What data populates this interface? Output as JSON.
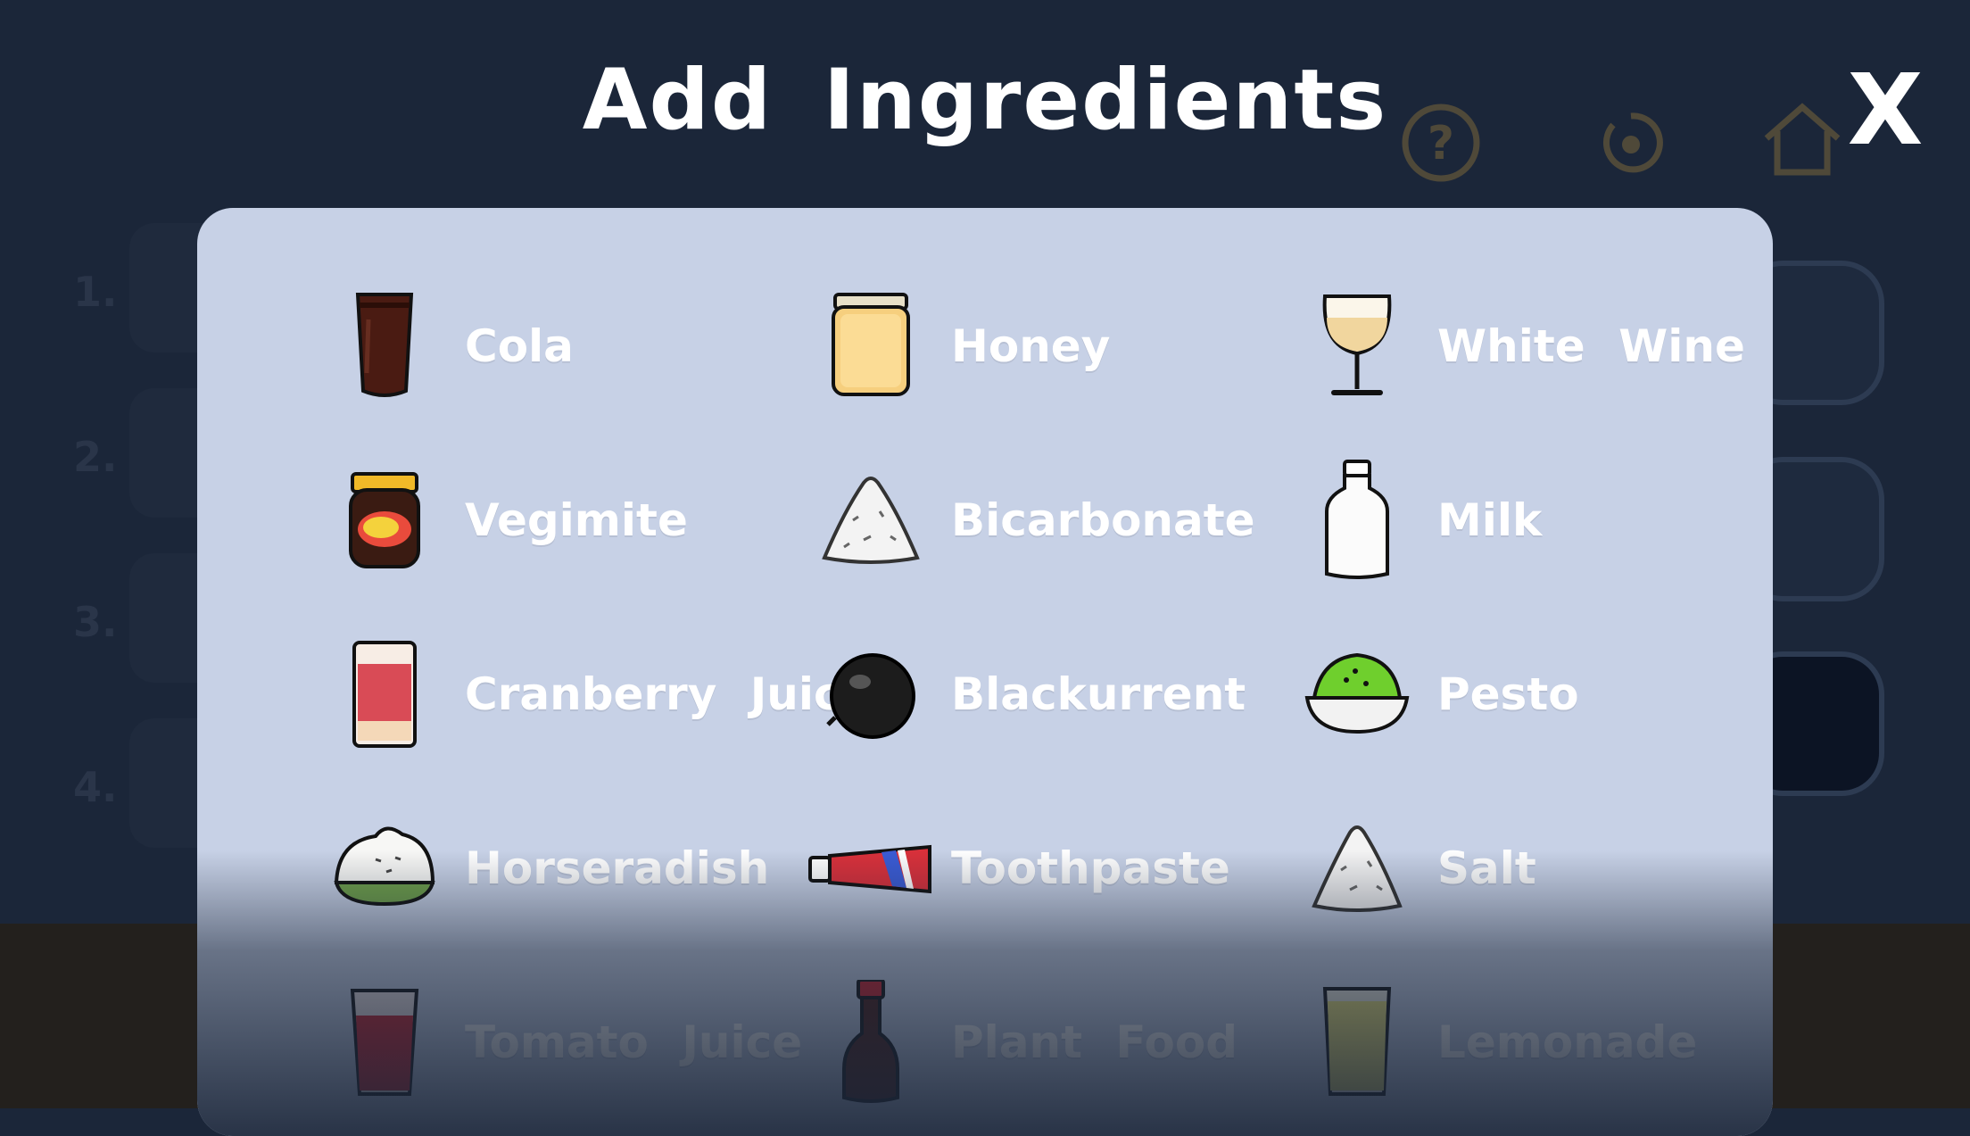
{
  "header": {
    "title": "Add Ingredients",
    "close_label": "X"
  },
  "background": {
    "row_numbers": [
      "1.",
      "2.",
      "3.",
      "4."
    ],
    "icons": [
      "help-icon",
      "reset-icon",
      "home-icon"
    ]
  },
  "ingredients": [
    {
      "label": "Cola",
      "icon": "cola-glass-icon"
    },
    {
      "label": "Honey",
      "icon": "honey-jar-icon"
    },
    {
      "label": "White Wine",
      "icon": "wine-glass-icon"
    },
    {
      "label": "Vegimite",
      "icon": "vegimite-jar-icon"
    },
    {
      "label": "Bicarbonate",
      "icon": "powder-pile-icon"
    },
    {
      "label": "Milk",
      "icon": "milk-bottle-icon"
    },
    {
      "label": "Cranberry Juice",
      "icon": "juice-glass-icon"
    },
    {
      "label": "Blackurrent",
      "icon": "blackcurrant-icon"
    },
    {
      "label": "Pesto",
      "icon": "pesto-bowl-icon"
    },
    {
      "label": "Horseradish",
      "icon": "horseradish-icon"
    },
    {
      "label": "Toothpaste",
      "icon": "toothpaste-icon"
    },
    {
      "label": "Salt",
      "icon": "salt-pile-icon"
    },
    {
      "label": "Tomato Juice",
      "icon": "tomato-glass-icon"
    },
    {
      "label": "Plant Food",
      "icon": "plant-food-bottle-icon"
    },
    {
      "label": "Lemonade",
      "icon": "lemonade-glass-icon"
    }
  ]
}
